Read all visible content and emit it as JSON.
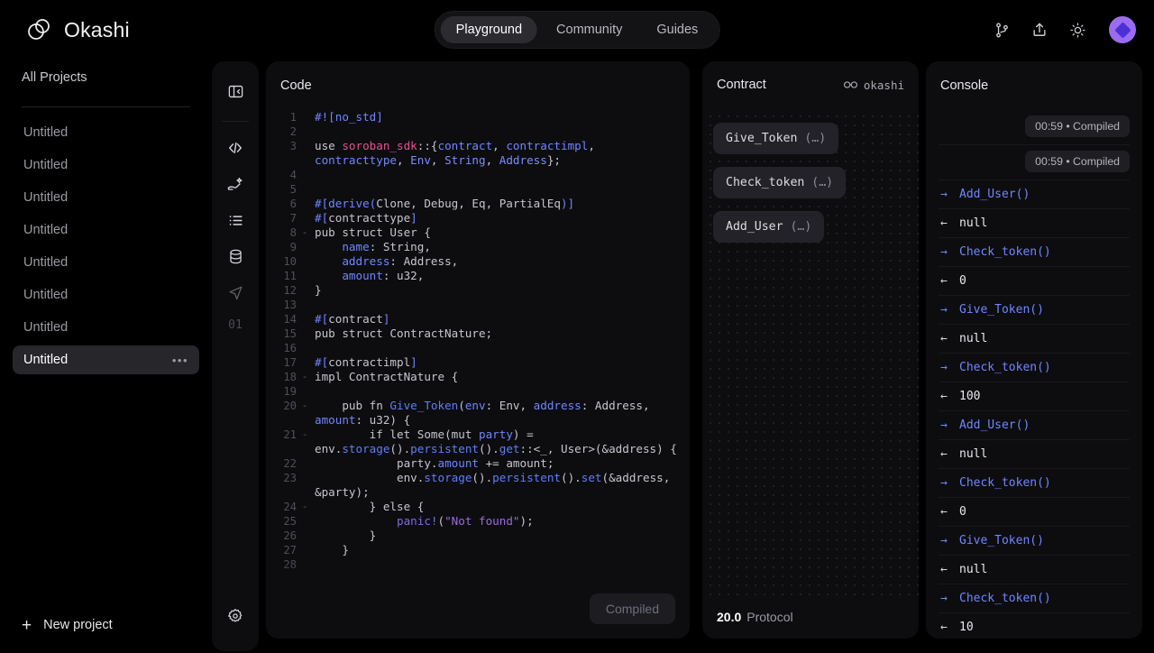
{
  "brand": {
    "name": "Okashi",
    "logo_icon": "two-circles-logo"
  },
  "nav": {
    "tabs": [
      {
        "label": "Playground",
        "active": true
      },
      {
        "label": "Community",
        "active": false
      },
      {
        "label": "Guides",
        "active": false
      }
    ]
  },
  "topbar_icons": [
    {
      "name": "git-branch-icon"
    },
    {
      "name": "share-upload-icon"
    },
    {
      "name": "sun-theme-icon"
    },
    {
      "name": "avatar"
    }
  ],
  "sidebar": {
    "heading": "All Projects",
    "items": [
      {
        "label": "Untitled",
        "selected": false
      },
      {
        "label": "Untitled",
        "selected": false
      },
      {
        "label": "Untitled",
        "selected": false
      },
      {
        "label": "Untitled",
        "selected": false
      },
      {
        "label": "Untitled",
        "selected": false
      },
      {
        "label": "Untitled",
        "selected": false
      },
      {
        "label": "Untitled",
        "selected": false
      },
      {
        "label": "Untitled",
        "selected": true
      }
    ],
    "item_menu_glyph": "•••",
    "new_project": {
      "label": "New project",
      "icon": "plus-icon"
    }
  },
  "rail": {
    "items": [
      {
        "name": "collapse-panel-icon",
        "dim": false
      },
      {
        "name": "code-icon",
        "dim": false
      },
      {
        "name": "magic-deploy-icon",
        "dim": false
      },
      {
        "name": "list-icon",
        "dim": false
      },
      {
        "name": "database-icon",
        "dim": false
      },
      {
        "name": "send-cursor-icon",
        "dim": true
      }
    ],
    "counter": "01",
    "settings_icon": "gear-icon"
  },
  "code_panel": {
    "title": "Code",
    "compiled_button": "Compiled",
    "lines": [
      {
        "n": "1",
        "fold": "",
        "tokens": [
          {
            "t": "attr",
            "v": "#![no_std]"
          }
        ]
      },
      {
        "n": "2",
        "fold": "",
        "tokens": []
      },
      {
        "n": "3",
        "fold": "",
        "tokens": [
          {
            "t": "kw",
            "v": "use "
          },
          {
            "t": "mod",
            "v": "soroban_sdk"
          },
          {
            "t": "plain",
            "v": "::{"
          },
          {
            "t": "ident",
            "v": "contract"
          },
          {
            "t": "plain",
            "v": ", "
          },
          {
            "t": "ident",
            "v": "contractimpl"
          },
          {
            "t": "plain",
            "v": ",\n"
          },
          {
            "t": "ident",
            "v": "contracttype"
          },
          {
            "t": "plain",
            "v": ", "
          },
          {
            "t": "type",
            "v": "Env"
          },
          {
            "t": "plain",
            "v": ", "
          },
          {
            "t": "type",
            "v": "String"
          },
          {
            "t": "plain",
            "v": ", "
          },
          {
            "t": "type",
            "v": "Address"
          },
          {
            "t": "plain",
            "v": "};"
          }
        ]
      },
      {
        "n": "4",
        "fold": "",
        "tokens": []
      },
      {
        "n": "5",
        "fold": "",
        "tokens": []
      },
      {
        "n": "6",
        "fold": "",
        "tokens": [
          {
            "t": "attr",
            "v": "#[derive("
          },
          {
            "t": "plain",
            "v": "Clone, Debug, Eq, PartialEq"
          },
          {
            "t": "attr",
            "v": ")]"
          }
        ]
      },
      {
        "n": "7",
        "fold": "",
        "tokens": [
          {
            "t": "attr",
            "v": "#["
          },
          {
            "t": "plain",
            "v": "contracttype"
          },
          {
            "t": "attr",
            "v": "]"
          }
        ]
      },
      {
        "n": "8",
        "fold": "-",
        "tokens": [
          {
            "t": "plain",
            "v": "pub struct User {"
          }
        ]
      },
      {
        "n": "9",
        "fold": "",
        "tokens": [
          {
            "t": "plain",
            "v": "    "
          },
          {
            "t": "ident",
            "v": "name"
          },
          {
            "t": "plain",
            "v": ": String,"
          }
        ]
      },
      {
        "n": "10",
        "fold": "",
        "tokens": [
          {
            "t": "plain",
            "v": "    "
          },
          {
            "t": "ident",
            "v": "address"
          },
          {
            "t": "plain",
            "v": ": Address,"
          }
        ]
      },
      {
        "n": "11",
        "fold": "",
        "tokens": [
          {
            "t": "plain",
            "v": "    "
          },
          {
            "t": "ident",
            "v": "amount"
          },
          {
            "t": "plain",
            "v": ": u32,"
          }
        ]
      },
      {
        "n": "12",
        "fold": "",
        "tokens": [
          {
            "t": "plain",
            "v": "}"
          }
        ]
      },
      {
        "n": "13",
        "fold": "",
        "tokens": []
      },
      {
        "n": "14",
        "fold": "",
        "tokens": [
          {
            "t": "attr",
            "v": "#["
          },
          {
            "t": "plain",
            "v": "contract"
          },
          {
            "t": "attr",
            "v": "]"
          }
        ]
      },
      {
        "n": "15",
        "fold": "",
        "tokens": [
          {
            "t": "plain",
            "v": "pub struct ContractNature;"
          }
        ]
      },
      {
        "n": "16",
        "fold": "",
        "tokens": []
      },
      {
        "n": "17",
        "fold": "",
        "tokens": [
          {
            "t": "attr",
            "v": "#["
          },
          {
            "t": "plain",
            "v": "contractimpl"
          },
          {
            "t": "attr",
            "v": "]"
          }
        ]
      },
      {
        "n": "18",
        "fold": "-",
        "tokens": [
          {
            "t": "plain",
            "v": "impl ContractNature {"
          }
        ]
      },
      {
        "n": "19",
        "fold": "",
        "tokens": []
      },
      {
        "n": "20",
        "fold": "-",
        "tokens": [
          {
            "t": "plain",
            "v": "    pub fn "
          },
          {
            "t": "fn",
            "v": "Give_Token"
          },
          {
            "t": "plain",
            "v": "("
          },
          {
            "t": "ident",
            "v": "env"
          },
          {
            "t": "plain",
            "v": ": Env, "
          },
          {
            "t": "ident",
            "v": "address"
          },
          {
            "t": "plain",
            "v": ": Address,\n"
          },
          {
            "t": "ident",
            "v": "amount"
          },
          {
            "t": "plain",
            "v": ": u32) {"
          }
        ]
      },
      {
        "n": "21",
        "fold": "-",
        "tokens": [
          {
            "t": "plain",
            "v": "        if let Some(mut "
          },
          {
            "t": "ident",
            "v": "party"
          },
          {
            "t": "plain",
            "v": ") =\n"
          },
          {
            "t": "plain",
            "v": "env."
          },
          {
            "t": "fn",
            "v": "storage"
          },
          {
            "t": "plain",
            "v": "()."
          },
          {
            "t": "fn",
            "v": "persistent"
          },
          {
            "t": "plain",
            "v": "()."
          },
          {
            "t": "fn",
            "v": "get"
          },
          {
            "t": "plain",
            "v": "::<_, User>(&address) {"
          }
        ]
      },
      {
        "n": "22",
        "fold": "",
        "tokens": [
          {
            "t": "plain",
            "v": "            party."
          },
          {
            "t": "ident",
            "v": "amount"
          },
          {
            "t": "plain",
            "v": " += amount;"
          }
        ]
      },
      {
        "n": "23",
        "fold": "",
        "tokens": [
          {
            "t": "plain",
            "v": "            env."
          },
          {
            "t": "fn",
            "v": "storage"
          },
          {
            "t": "plain",
            "v": "()."
          },
          {
            "t": "fn",
            "v": "persistent"
          },
          {
            "t": "plain",
            "v": "()."
          },
          {
            "t": "fn",
            "v": "set"
          },
          {
            "t": "plain",
            "v": "(&address,\n&party);"
          }
        ]
      },
      {
        "n": "24",
        "fold": "-",
        "tokens": [
          {
            "t": "plain",
            "v": "        } else {"
          }
        ]
      },
      {
        "n": "25",
        "fold": "",
        "tokens": [
          {
            "t": "plain",
            "v": "            "
          },
          {
            "t": "macro",
            "v": "panic!"
          },
          {
            "t": "plain",
            "v": "("
          },
          {
            "t": "str",
            "v": "\"Not found\""
          },
          {
            "t": "plain",
            "v": ");"
          }
        ]
      },
      {
        "n": "26",
        "fold": "",
        "tokens": [
          {
            "t": "plain",
            "v": "        }"
          }
        ]
      },
      {
        "n": "27",
        "fold": "",
        "tokens": [
          {
            "t": "plain",
            "v": "    }"
          }
        ]
      },
      {
        "n": "28",
        "fold": "",
        "tokens": []
      }
    ]
  },
  "contract_panel": {
    "title": "Contract",
    "badge": {
      "icon": "link-chain-icon",
      "label": "okashi"
    },
    "functions": [
      {
        "name": "Give_Token",
        "args": "(…)"
      },
      {
        "name": "Check_token",
        "args": "(…)"
      },
      {
        "name": "Add_User",
        "args": "(…)"
      }
    ],
    "footer": {
      "version": "20.0",
      "label": "Protocol"
    }
  },
  "console_panel": {
    "title": "Console",
    "stamps": [
      "00:59 • Compiled",
      "00:59 • Compiled"
    ],
    "entries": [
      {
        "dir": "call",
        "arrow": "→",
        "text": "Add_User()"
      },
      {
        "dir": "ret",
        "arrow": "←",
        "text": "null"
      },
      {
        "dir": "call",
        "arrow": "→",
        "text": "Check_token()"
      },
      {
        "dir": "ret",
        "arrow": "←",
        "text": "0"
      },
      {
        "dir": "call",
        "arrow": "→",
        "text": "Give_Token()"
      },
      {
        "dir": "ret",
        "arrow": "←",
        "text": "null"
      },
      {
        "dir": "call",
        "arrow": "→",
        "text": "Check_token()"
      },
      {
        "dir": "ret",
        "arrow": "←",
        "text": "100"
      },
      {
        "dir": "call",
        "arrow": "→",
        "text": "Add_User()"
      },
      {
        "dir": "ret",
        "arrow": "←",
        "text": "null"
      },
      {
        "dir": "call",
        "arrow": "→",
        "text": "Check_token()"
      },
      {
        "dir": "ret",
        "arrow": "←",
        "text": "0"
      },
      {
        "dir": "call",
        "arrow": "→",
        "text": "Give_Token()"
      },
      {
        "dir": "ret",
        "arrow": "←",
        "text": "null"
      },
      {
        "dir": "call",
        "arrow": "→",
        "text": "Check_token()"
      },
      {
        "dir": "ret",
        "arrow": "←",
        "text": "10"
      }
    ]
  },
  "colors": {
    "background": "#000000",
    "panel": "#0d0d10",
    "accent_blue": "#6f86ff",
    "avatar_purple": "#9b6cf0",
    "selected_item": "#26262b"
  }
}
